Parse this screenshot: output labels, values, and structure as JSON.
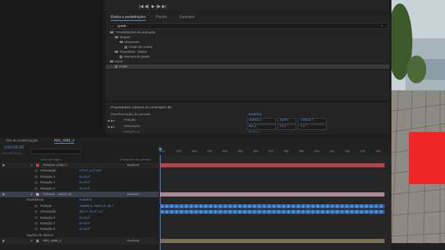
{
  "media_controls": [
    "|◀",
    "◀|",
    "▶",
    "|▶",
    "▶|"
  ],
  "effects_panel": {
    "tabs": [
      "Efeitos e predefinições",
      "Pincéis",
      "Caractere"
    ],
    "search_value": "grade",
    "tree": [
      {
        "label": "* Predefinições de animação",
        "level": 0,
        "type": "folder"
      },
      {
        "label": "Shapes",
        "level": 1,
        "type": "folder"
      },
      {
        "label": "Elementos",
        "level": 2,
        "type": "folder"
      },
      {
        "label": "Grade de cruzes",
        "level": 3,
        "type": "effect"
      },
      {
        "label": "Transitions - Wipes",
        "level": 1,
        "type": "folder"
      },
      {
        "label": "Abertura de grade",
        "level": 2,
        "type": "effect"
      },
      {
        "label": "Gerar",
        "level": 0,
        "type": "folder"
      },
      {
        "label": "Grade",
        "level": 1,
        "type": "effect"
      }
    ]
  },
  "properties_panel": {
    "title": "Propriedades: Câmera do controlador 3D",
    "section": "Transformação da camada",
    "reset": "Redefinir",
    "rows": [
      {
        "label": "Posição",
        "values": [
          "-20693,4",
          "15401",
          "-44545,7"
        ]
      },
      {
        "label": "Orientação",
        "values": [
          "351,1 °",
          "24,3 °",
          "1,0 °"
        ]
      },
      {
        "label": "Rotação X",
        "values": [
          "0x+0,0 °"
        ]
      }
    ]
  },
  "timeline": {
    "tabs": [
      "Fila de renderização",
      "IMG_6686_2"
    ],
    "timecode": "0:00:00:00",
    "fps": "0:00 (30,00 fps)",
    "columns": [
      "Nome da origem",
      "Transformar em principal..."
    ],
    "ruler": [
      "0s",
      "01s",
      "02s",
      "03s",
      "04s",
      "05s",
      "06s",
      "07s",
      "08s",
      "09s",
      "10s",
      "11s",
      "12s",
      "13s",
      "14s"
    ],
    "rows": [
      {
        "num": "1",
        "name": "Rastrear sólido 1",
        "type": "layer",
        "color": "#c84b4b",
        "parent": "Nenhum"
      },
      {
        "name": "Orientação",
        "value": "270,0°,0,0°,0,0°",
        "type": "prop"
      },
      {
        "name": "Rotação X",
        "value": "0x+0,0°",
        "type": "prop"
      },
      {
        "name": "Rotação Y",
        "value": "0x+0,0°",
        "type": "prop"
      },
      {
        "name": "Rotação Z",
        "value": "0x+0,0°",
        "type": "prop"
      },
      {
        "num": "2",
        "name": "Câmera ...olador 3D",
        "type": "layer",
        "color": "#c8a0a8",
        "parent": "Nenhum"
      },
      {
        "name": "Transformar",
        "value": "Redefinir",
        "type": "group"
      },
      {
        "name": "Posição",
        "value": "-20693,4,-15401,6,-45,7",
        "type": "prop"
      },
      {
        "name": "Orientação",
        "value": "351,1°,24,3°,1,0°",
        "type": "prop"
      },
      {
        "name": "Rotação X",
        "value": "0x+0,0°",
        "type": "prop"
      },
      {
        "name": "Rotação Y",
        "value": "0x+0,0°",
        "type": "prop"
      },
      {
        "name": "Rotação Z",
        "value": "0x+0,0°",
        "type": "prop"
      },
      {
        "name": "Opções de câmera",
        "type": "group"
      },
      {
        "num": "3",
        "name": "IMG_6686_2",
        "type": "layer",
        "color": "#8a7e64",
        "parent": "Nenhum"
      }
    ]
  },
  "colors": {
    "accent": "#5a8fd6",
    "solid_layer": "#c84b4b",
    "camera_layer": "#c8a0a8",
    "footage_layer": "#8a7e64",
    "keyframe": "#4a8fe0",
    "preview_red": "#ef2727"
  }
}
